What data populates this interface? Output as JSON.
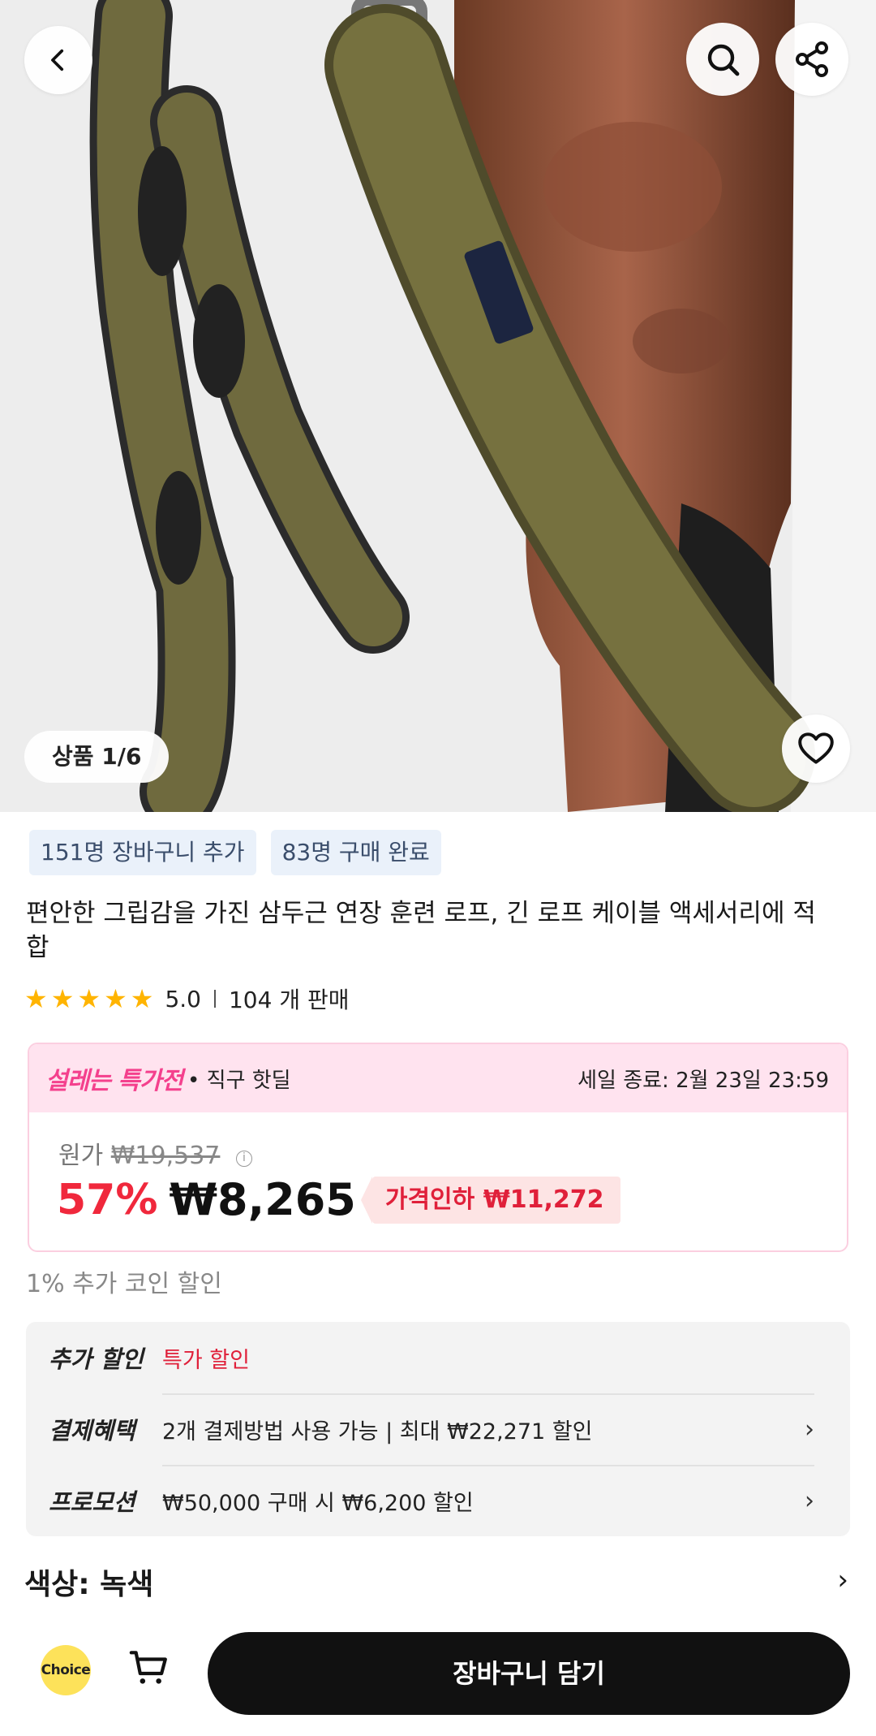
{
  "gallery": {
    "counter": "상품 1/6",
    "image_alt": "Triceps rope training straps"
  },
  "badges": [
    "151명 장바구니 추가",
    "83명 구매 완료"
  ],
  "product": {
    "title": "편안한 그립감을 가진 삼두근 연장 훈련 로프, 긴 로프 케이블 액세서리에 적합",
    "rating": "5.0",
    "sold": "104 개 판매",
    "stars": 5
  },
  "sale": {
    "logo": "설레는 특가전",
    "subtitle": "• 직구 핫딜",
    "end": "세일 종료: 2월 23일 23:59",
    "original_label": "원가",
    "original_price": "₩19,537",
    "discount": "57%",
    "price": "₩8,265",
    "price_drop": "가격인하 ₩11,272"
  },
  "coin_discount": "1% 추가 코인 할인",
  "discounts": [
    {
      "label": "추가 할인",
      "value": "특가 할인",
      "highlight": true
    },
    {
      "label": "결제혜택",
      "value": "2개 결제방법 사용 가능 | 최대 ₩22,271 할인"
    },
    {
      "label": "프로모션",
      "value": "₩50,000 구매 시 ₩6,200 할인"
    }
  ],
  "color_option": "색상: 녹색",
  "bottom": {
    "choice": "Choice",
    "add_to_cart": "장바구니 담기"
  },
  "colors": {
    "strap": "#6f6a3e",
    "accent_red": "#f0283c",
    "sale_pink": "#f4408d"
  }
}
